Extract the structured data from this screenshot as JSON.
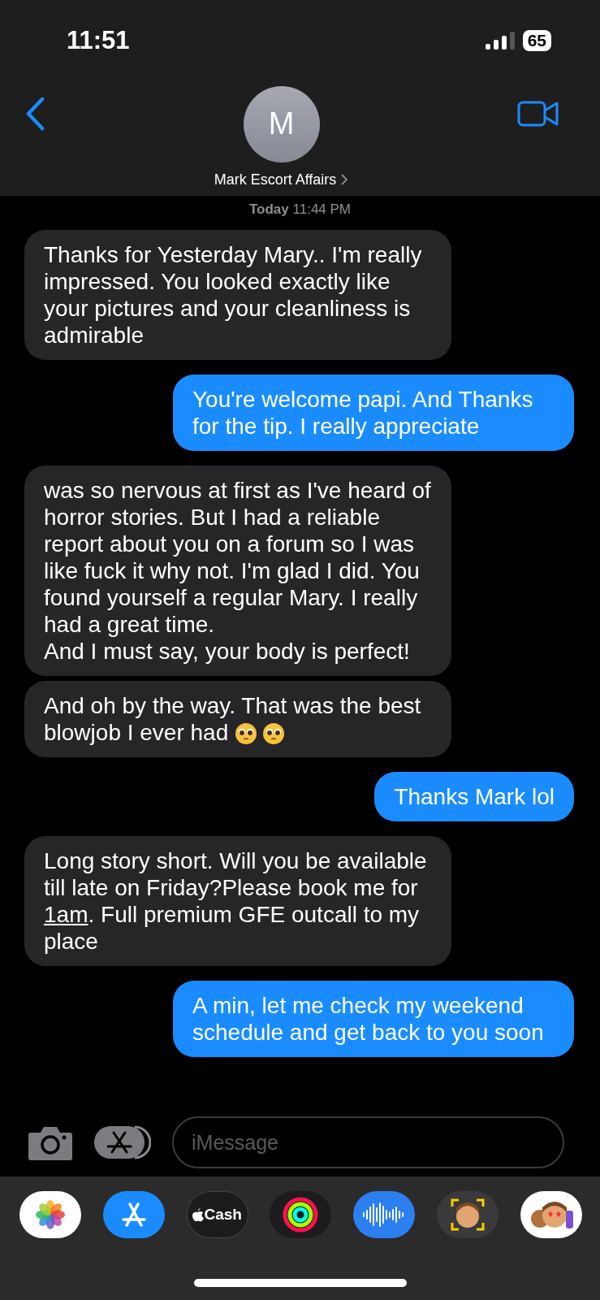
{
  "status_bar": {
    "time": "11:51",
    "battery": "65"
  },
  "header": {
    "avatar_initial": "M",
    "contact_name": "Mark Escort Affairs"
  },
  "timestamp": {
    "day": "Today",
    "time": "11:44 PM"
  },
  "messages": [
    {
      "kind": "received",
      "parts": [
        {
          "kind": "text",
          "text": "Thanks for Yesterday Mary.. I'm really impressed. You looked exactly like your pictures and your cleanliness is admirable"
        }
      ]
    },
    {
      "kind": "sent",
      "parts": [
        {
          "kind": "text",
          "text": "You're welcome papi. And Thanks for the tip. I really appreciate"
        }
      ]
    },
    {
      "kind": "received",
      "parts": [
        {
          "kind": "text",
          "text": "was so nervous at first as I've heard of horror stories. But I had a reliable report about you on a forum so I was like fuck it why not. I'm glad I did. You found yourself a regular Mary. I really had a great time.\nAnd I must say, your body is perfect!"
        }
      ]
    },
    {
      "kind": "received",
      "parts": [
        {
          "kind": "text",
          "text": "And oh by the way. That was the best blowjob I ever had "
        },
        {
          "kind": "emoji"
        },
        {
          "kind": "emoji"
        }
      ]
    },
    {
      "kind": "sent",
      "parts": [
        {
          "kind": "text",
          "text": "Thanks Mark lol"
        }
      ]
    },
    {
      "kind": "received",
      "parts": [
        {
          "kind": "text",
          "text": "Long story short. Will you be available till late on Friday?Please book me for "
        },
        {
          "kind": "link",
          "text": "1am"
        },
        {
          "kind": "text",
          "text": ". Full premium GFE outcall to my place"
        }
      ]
    },
    {
      "kind": "sent",
      "parts": [
        {
          "kind": "text",
          "text": "A min, let me check my weekend schedule and get back to you soon"
        }
      ]
    }
  ],
  "composer": {
    "placeholder": "iMessage"
  },
  "app_tray": [
    {
      "kind": "photos"
    },
    {
      "kind": "appstore"
    },
    {
      "kind": "cash",
      "label": "Cash"
    },
    {
      "kind": "activity"
    },
    {
      "kind": "audio"
    },
    {
      "kind": "memoji"
    },
    {
      "kind": "stickers"
    }
  ]
}
